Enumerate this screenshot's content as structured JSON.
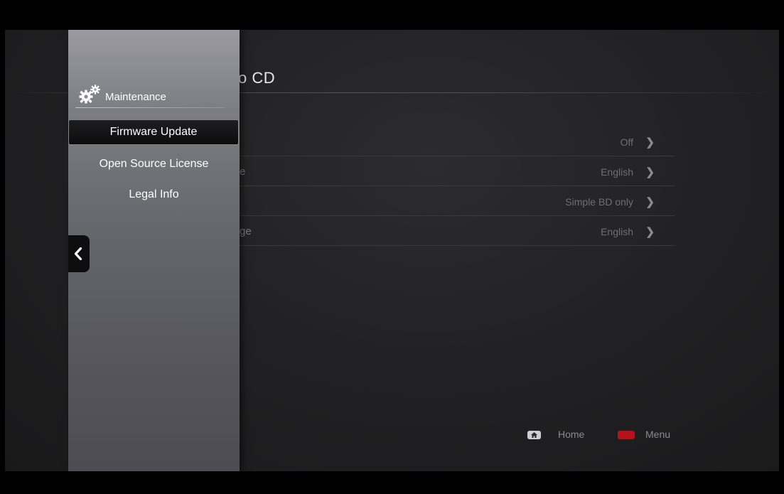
{
  "page": {
    "title": "Audio CD",
    "title_visible": "o CD"
  },
  "settings": [
    {
      "label_visible": "",
      "value": "Off"
    },
    {
      "label_visible": "e",
      "value": "English"
    },
    {
      "label_visible": "",
      "value": "Simple BD only"
    },
    {
      "label_visible": "ge",
      "value": "English"
    }
  ],
  "footer": {
    "home_label": "Home",
    "menu_label": "Menu",
    "home_icon": "home-icon",
    "menu_button_color": "#b5121b"
  },
  "drawer": {
    "title": "Maintenance",
    "icon": "gears-icon",
    "items": [
      {
        "label": "Firmware Update",
        "selected": true
      },
      {
        "label": "Open Source License",
        "selected": false
      },
      {
        "label": "Legal Info",
        "selected": false
      }
    ],
    "collapse_icon": "chevron-left-icon"
  },
  "colors": {
    "accent_red": "#b5121b",
    "selection_border": "#7e8690"
  }
}
